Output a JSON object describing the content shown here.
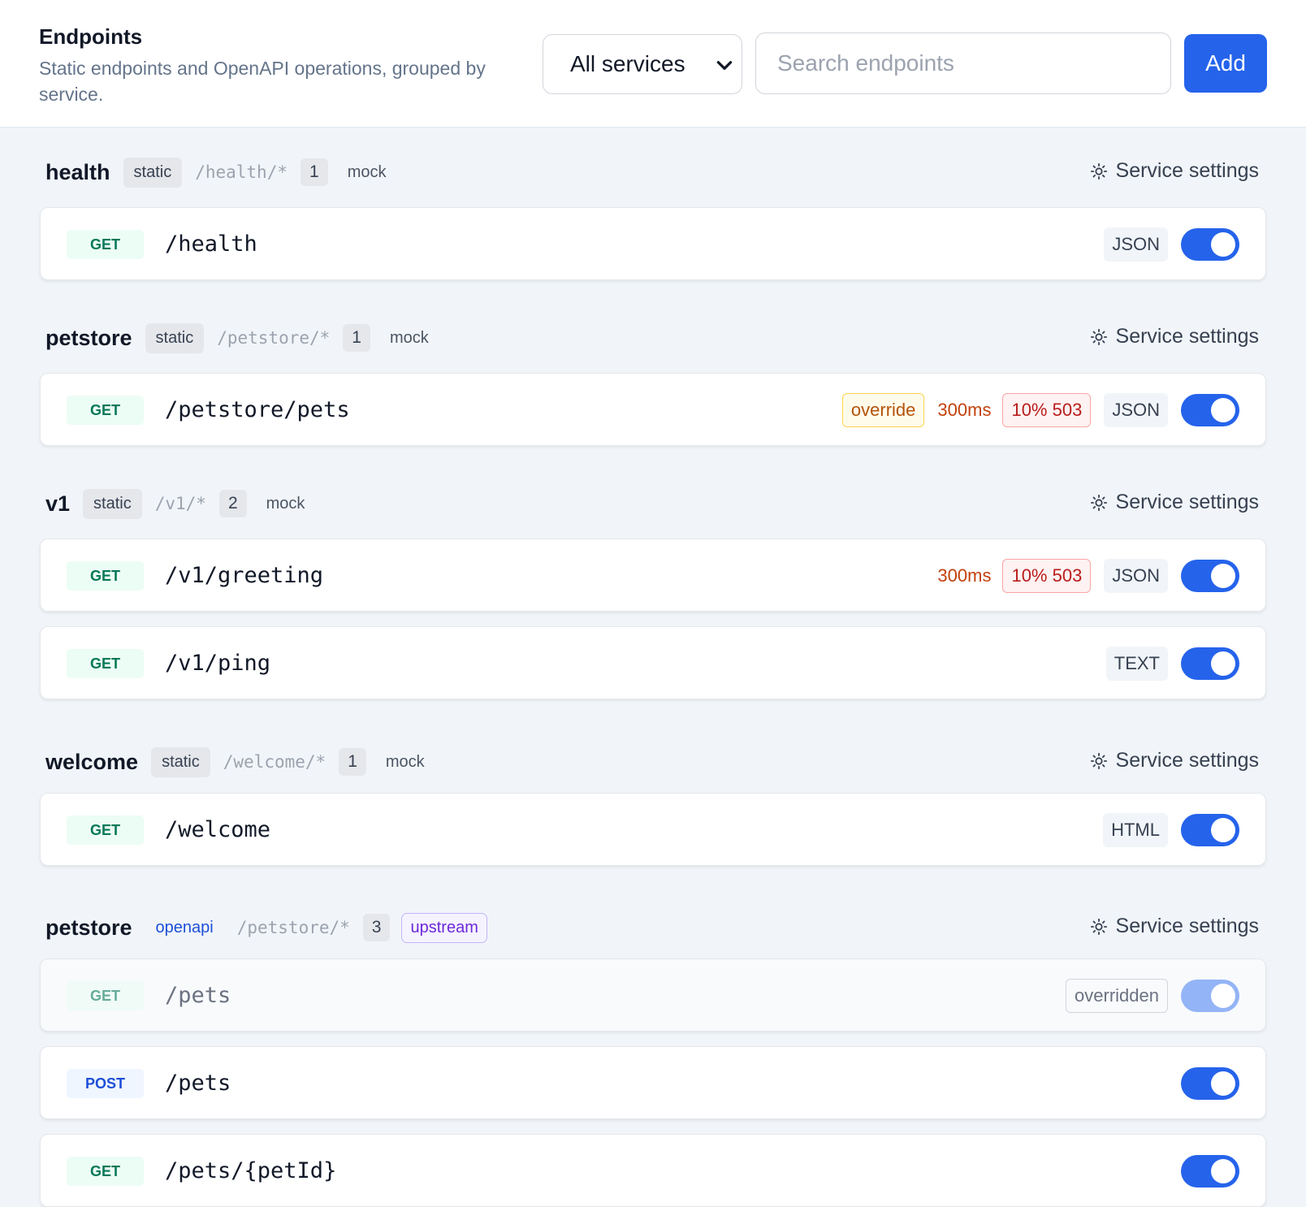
{
  "header": {
    "title": "Endpoints",
    "subtitle": "Static endpoints and OpenAPI operations, grouped by service.",
    "service_filter": "All services",
    "search_placeholder": "Search endpoints",
    "add_label": "Add"
  },
  "groups": [
    {
      "name": "health",
      "kind": "static",
      "prefix": "/health/*",
      "count": "1",
      "mode": "mock",
      "settings_label": "Service settings",
      "endpoints": [
        {
          "method": "GET",
          "path": "/health",
          "format": "JSON",
          "enabled": true
        }
      ]
    },
    {
      "name": "petstore",
      "kind": "static",
      "prefix": "/petstore/*",
      "count": "1",
      "mode": "mock",
      "settings_label": "Service settings",
      "endpoints": [
        {
          "method": "GET",
          "path": "/petstore/pets",
          "override": "override",
          "latency": "300ms",
          "error": "10% 503",
          "format": "JSON",
          "enabled": true
        }
      ]
    },
    {
      "name": "v1",
      "kind": "static",
      "prefix": "/v1/*",
      "count": "2",
      "mode": "mock",
      "settings_label": "Service settings",
      "endpoints": [
        {
          "method": "GET",
          "path": "/v1/greeting",
          "latency": "300ms",
          "error": "10% 503",
          "format": "JSON",
          "enabled": true
        },
        {
          "method": "GET",
          "path": "/v1/ping",
          "format": "TEXT",
          "enabled": true
        }
      ]
    },
    {
      "name": "welcome",
      "kind": "static",
      "prefix": "/welcome/*",
      "count": "1",
      "mode": "mock",
      "settings_label": "Service settings",
      "endpoints": [
        {
          "method": "GET",
          "path": "/welcome",
          "format": "HTML",
          "enabled": true
        }
      ]
    },
    {
      "name": "petstore",
      "kind": "openapi",
      "prefix": "/petstore/*",
      "count": "3",
      "mode": "upstream",
      "settings_label": "Service settings",
      "endpoints": [
        {
          "method": "GET",
          "path": "/pets",
          "status": "overridden",
          "enabled": true
        },
        {
          "method": "POST",
          "path": "/pets",
          "enabled": true
        },
        {
          "method": "GET",
          "path": "/pets/{petId}",
          "enabled": true
        }
      ]
    }
  ],
  "colors": {
    "accent": "#2563eb",
    "get_method": "#047857",
    "post_method": "#1d4ed8",
    "latency": "#c2410c",
    "error": "#b91c1c",
    "override": "#b45309",
    "upstream": "#6d28d9"
  }
}
